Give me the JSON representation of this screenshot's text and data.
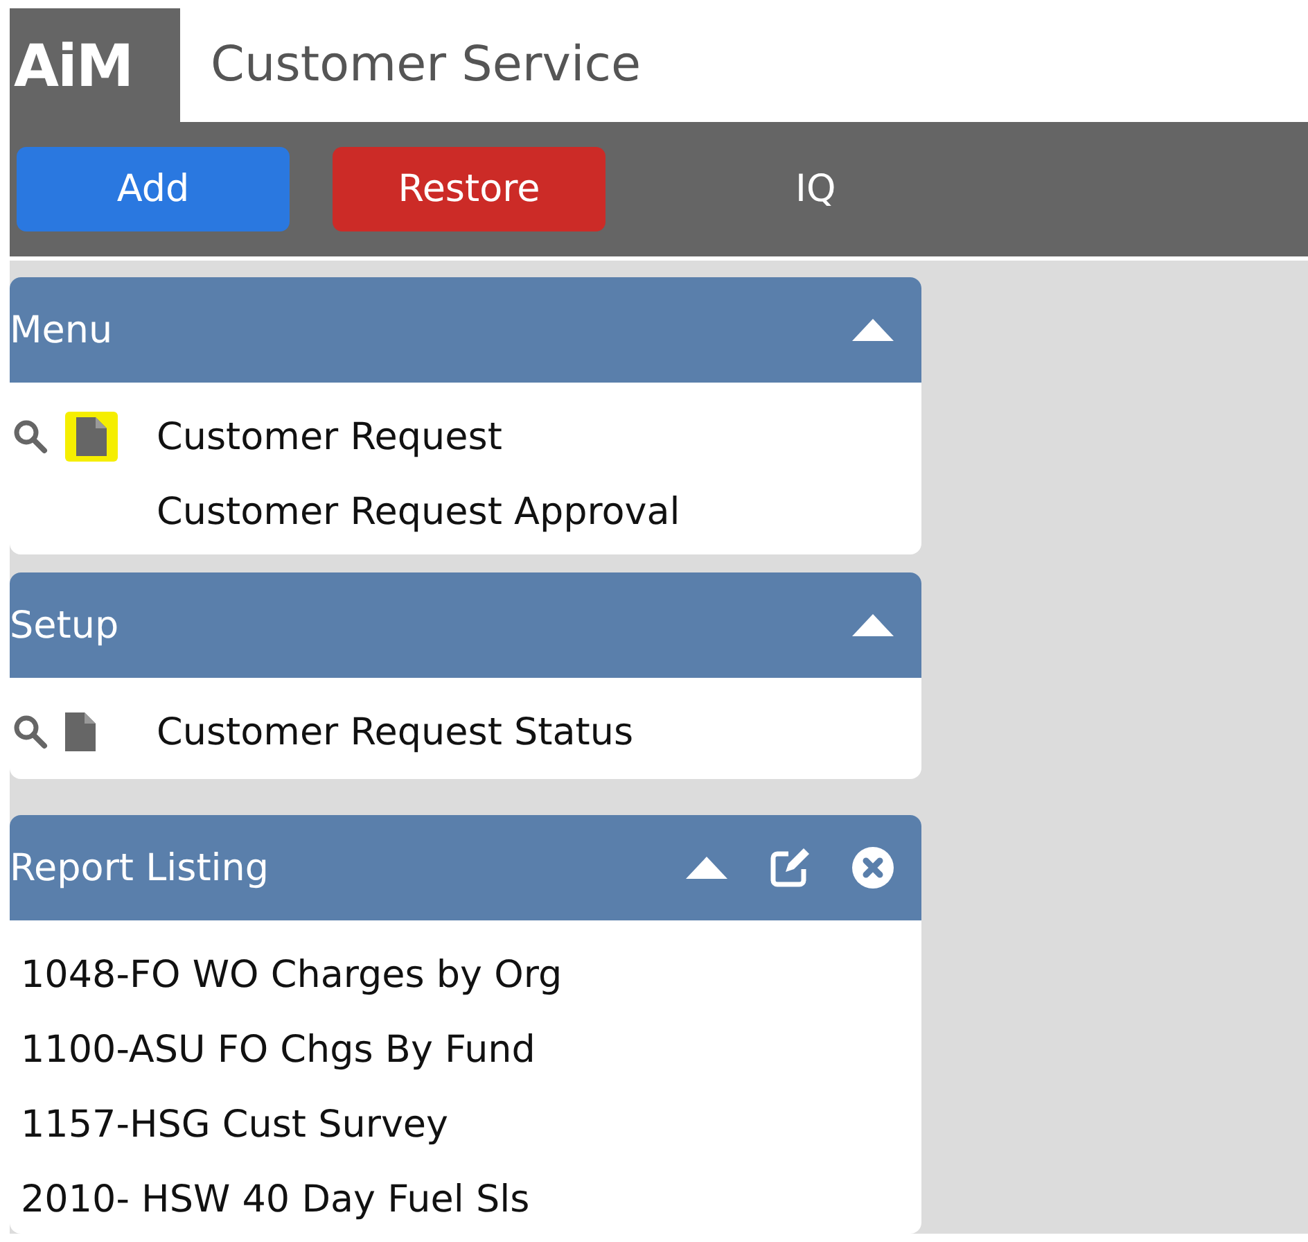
{
  "app": {
    "logo": "AiM",
    "title": "Customer Service"
  },
  "toolbar": [
    {
      "label": "Add",
      "kind": "primary"
    },
    {
      "label": "Restore",
      "kind": "danger"
    },
    {
      "label": "IQ",
      "kind": "plain"
    }
  ],
  "panels": [
    {
      "title": "Menu",
      "kind": "menu",
      "expanded": true,
      "editable": false,
      "closable": false,
      "items": [
        {
          "label": "Customer Request",
          "icons": true,
          "highlighted": true
        },
        {
          "label": "Customer Request Approval",
          "icons": false,
          "highlighted": false
        }
      ]
    },
    {
      "title": "Setup",
      "kind": "menu",
      "expanded": true,
      "editable": false,
      "closable": false,
      "items": [
        {
          "label": "Customer Request Status",
          "icons": true,
          "highlighted": false
        }
      ]
    },
    {
      "title": "Report Listing",
      "kind": "report",
      "expanded": true,
      "editable": true,
      "closable": true,
      "items": [
        {
          "label": "1048-FO WO Charges by Org",
          "icons": false,
          "highlighted": false
        },
        {
          "label": "1100-ASU FO Chgs By Fund",
          "icons": false,
          "highlighted": false
        },
        {
          "label": "1157-HSG Cust Survey",
          "icons": false,
          "highlighted": false
        },
        {
          "label": "2010- HSW 40 Day Fuel Sls",
          "icons": false,
          "highlighted": false
        }
      ]
    }
  ]
}
